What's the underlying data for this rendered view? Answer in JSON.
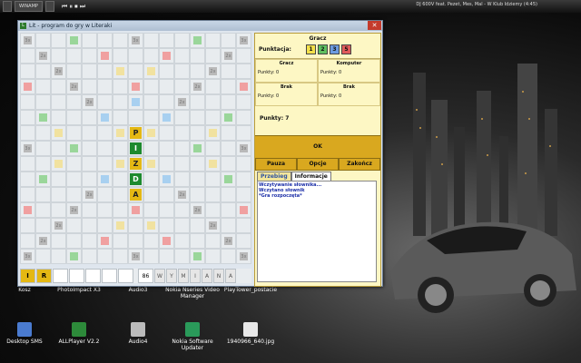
{
  "taskbar": {
    "items": [
      "",
      "WINAMP",
      ""
    ],
    "media_controls": "⏮ ⏸ ⏹ ⏭",
    "song": "DJ 600V feat. Pezet, Mes, Mal - W Klub Idziemy (4:45)"
  },
  "desktop_icons": [
    {
      "label": "Kosz"
    },
    {
      "label": "PhotoImpact X3"
    },
    {
      "label": "Audio3"
    },
    {
      "label": "Nokia Nseries Video Manager"
    },
    {
      "label": "PlayTower_postacie"
    },
    {
      "label": "Desktop SMS"
    },
    {
      "label": "ALLPlayer V2.2"
    },
    {
      "label": "Audio4"
    },
    {
      "label": "Nokia Software Updater"
    },
    {
      "label": "1940966_640.jpg"
    }
  ],
  "window": {
    "title": "Lit - program do gry w Literaki"
  },
  "board": {
    "tiles": {
      "7,6": "P",
      "7,7": "I",
      "7,8": "Z",
      "7,9": "D",
      "7,10": "A"
    }
  },
  "rack": {
    "tiles": [
      "I",
      "R"
    ],
    "count": "86",
    "exchange": [
      "W",
      "Y",
      "M",
      "I",
      "A",
      "N",
      "A"
    ]
  },
  "panel": {
    "current_player": "Gracz",
    "punktacja_label": "Punktacja:",
    "punktacja_values": [
      "1",
      "2",
      "3",
      "5"
    ],
    "players": [
      {
        "name": "Gracz",
        "points": "Punkty: 0"
      },
      {
        "name": "Komputer",
        "points": "Punkty: 0"
      },
      {
        "name": "Brak",
        "points": "Punkty: 0"
      },
      {
        "name": "Brak",
        "points": "Punkty: 0"
      }
    ],
    "score": "Punkty: 7",
    "ok_label": "OK",
    "buttons": [
      "Pauza",
      "Opcje",
      "Zakończ"
    ],
    "tabs": [
      "Przebieg",
      "Informacje"
    ],
    "log": [
      "Wczytywanie słownika...",
      "Wczytano słownik",
      "*Gra rozpoczęta*"
    ]
  },
  "colors": {
    "green": "#9ad69a",
    "red": "#f0a0a0",
    "yellow": "#f1e2a0",
    "blue": "#a8d0f0",
    "gray": "#b9b9b9"
  }
}
